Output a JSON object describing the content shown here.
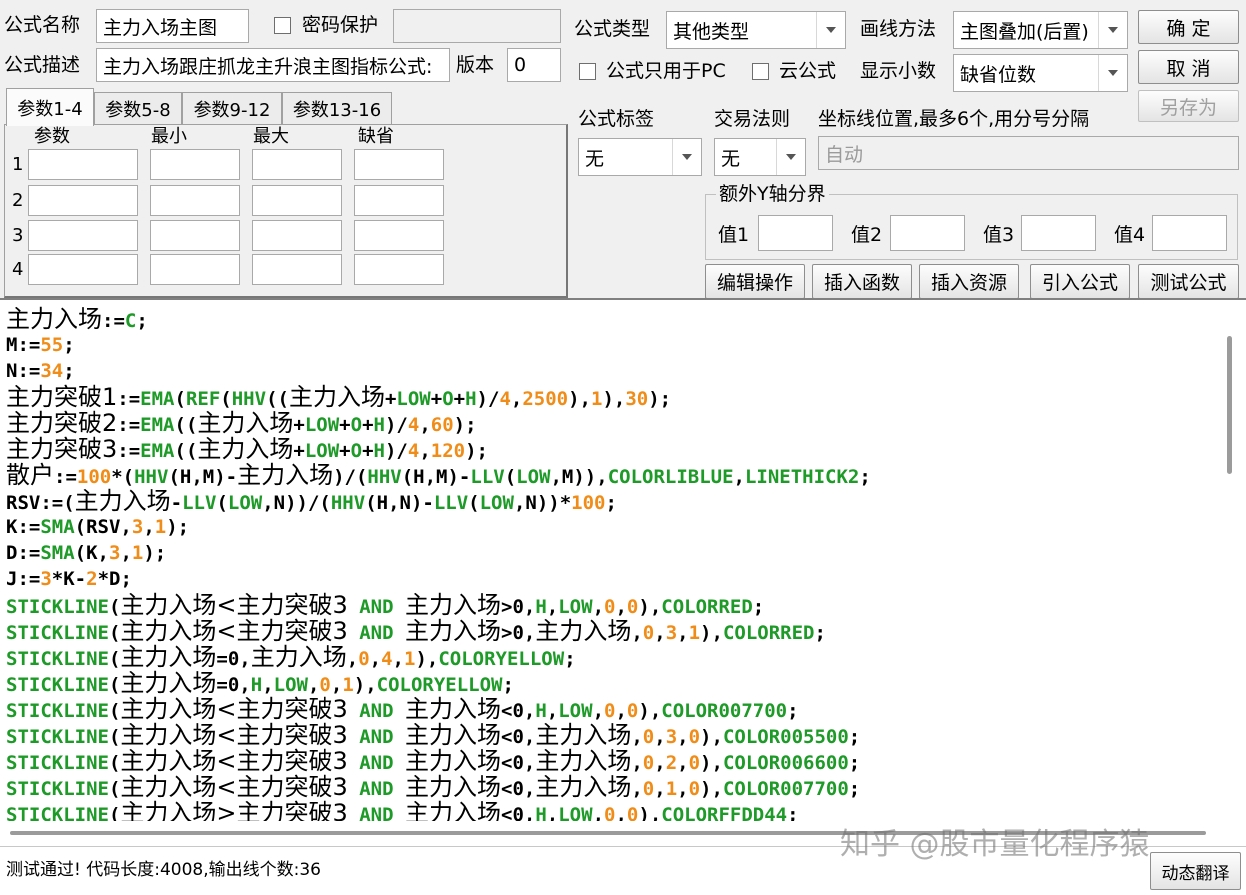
{
  "header": {
    "name_label": "公式名称",
    "name_value": "主力入场主图",
    "password_label": "密码保护",
    "desc_label": "公式描述",
    "desc_value": "主力入场跟庄抓龙主升浪主图指标公式:",
    "version_label": "版本",
    "version_value": "0",
    "type_label": "公式类型",
    "type_value": "其他类型",
    "draw_label": "画线方法",
    "draw_value": "主图叠加(后置)",
    "pc_only_label": "公式只用于PC",
    "cloud_label": "云公式",
    "decimal_label": "显示小数",
    "decimal_value": "缺省位数",
    "ok_label": "确  定",
    "cancel_label": "取  消",
    "saveas_label": "另存为"
  },
  "params": {
    "tabs": [
      "参数1-4",
      "参数5-8",
      "参数9-12",
      "参数13-16"
    ],
    "columns": [
      "参数",
      "最小",
      "最大",
      "缺省"
    ],
    "rows": [
      "1",
      "2",
      "3",
      "4"
    ]
  },
  "options": {
    "tag_label": "公式标签",
    "tag_value": "无",
    "rule_label": "交易法则",
    "rule_value": "无",
    "axis_label": "坐标线位置,最多6个,用分号分隔",
    "axis_value": "自动",
    "yaxis_group": "额外Y轴分界",
    "y_labels": [
      "值1",
      "值2",
      "值3",
      "值4"
    ]
  },
  "actions": [
    "编辑操作",
    "插入函数",
    "插入资源",
    "引入公式",
    "测试公式"
  ],
  "code_lines": [
    [
      [
        "k",
        "主力入场"
      ],
      [
        "o",
        ":="
      ],
      [
        "f",
        "C"
      ],
      [
        "o",
        ";"
      ]
    ],
    [
      [
        "k",
        "M"
      ],
      [
        "o",
        ":="
      ],
      [
        "n",
        "55"
      ],
      [
        "o",
        ";"
      ]
    ],
    [
      [
        "k",
        "N"
      ],
      [
        "o",
        ":="
      ],
      [
        "n",
        "34"
      ],
      [
        "o",
        ";"
      ]
    ],
    [
      [
        "k",
        "主力突破1"
      ],
      [
        "o",
        ":="
      ],
      [
        "f",
        "EMA"
      ],
      [
        "o",
        "("
      ],
      [
        "f",
        "REF"
      ],
      [
        "o",
        "("
      ],
      [
        "f",
        "HHV"
      ],
      [
        "o",
        "(("
      ],
      [
        "k",
        "主力入场"
      ],
      [
        "o",
        "+"
      ],
      [
        "f",
        "LOW"
      ],
      [
        "o",
        "+"
      ],
      [
        "f",
        "O"
      ],
      [
        "o",
        "+"
      ],
      [
        "f",
        "H"
      ],
      [
        "o",
        ")/"
      ],
      [
        "n",
        "4"
      ],
      [
        "o",
        ","
      ],
      [
        "n",
        "2500"
      ],
      [
        "o",
        "),"
      ],
      [
        "n",
        "1"
      ],
      [
        "o",
        "),"
      ],
      [
        "n",
        "30"
      ],
      [
        "o",
        ");"
      ]
    ],
    [
      [
        "k",
        "主力突破2"
      ],
      [
        "o",
        ":="
      ],
      [
        "f",
        "EMA"
      ],
      [
        "o",
        "(("
      ],
      [
        "k",
        "主力入场"
      ],
      [
        "o",
        "+"
      ],
      [
        "f",
        "LOW"
      ],
      [
        "o",
        "+"
      ],
      [
        "f",
        "O"
      ],
      [
        "o",
        "+"
      ],
      [
        "f",
        "H"
      ],
      [
        "o",
        ")/"
      ],
      [
        "n",
        "4"
      ],
      [
        "o",
        ","
      ],
      [
        "n",
        "60"
      ],
      [
        "o",
        ");"
      ]
    ],
    [
      [
        "k",
        "主力突破3"
      ],
      [
        "o",
        ":="
      ],
      [
        "f",
        "EMA"
      ],
      [
        "o",
        "(("
      ],
      [
        "k",
        "主力入场"
      ],
      [
        "o",
        "+"
      ],
      [
        "f",
        "LOW"
      ],
      [
        "o",
        "+"
      ],
      [
        "f",
        "O"
      ],
      [
        "o",
        "+"
      ],
      [
        "f",
        "H"
      ],
      [
        "o",
        ")/"
      ],
      [
        "n",
        "4"
      ],
      [
        "o",
        ","
      ],
      [
        "n",
        "120"
      ],
      [
        "o",
        ");"
      ]
    ],
    [
      [
        "k",
        "散户"
      ],
      [
        "o",
        ":="
      ],
      [
        "n",
        "100"
      ],
      [
        "o",
        "*("
      ],
      [
        "f",
        "HHV"
      ],
      [
        "o",
        "(H,M)-"
      ],
      [
        "k",
        "主力入场"
      ],
      [
        "o",
        ")/("
      ],
      [
        "f",
        "HHV"
      ],
      [
        "o",
        "(H,M)-"
      ],
      [
        "f",
        "LLV"
      ],
      [
        "o",
        "("
      ],
      [
        "f",
        "LOW"
      ],
      [
        "o",
        ",M)),"
      ],
      [
        "f",
        "COLORLIBLUE"
      ],
      [
        "o",
        ","
      ],
      [
        "f",
        "LINETHICK2"
      ],
      [
        "o",
        ";"
      ]
    ],
    [
      [
        "k",
        "RSV"
      ],
      [
        "o",
        ":=("
      ],
      [
        "k",
        "主力入场"
      ],
      [
        "o",
        "-"
      ],
      [
        "f",
        "LLV"
      ],
      [
        "o",
        "("
      ],
      [
        "f",
        "LOW"
      ],
      [
        "o",
        ",N))/("
      ],
      [
        "f",
        "HHV"
      ],
      [
        "o",
        "(H,N)-"
      ],
      [
        "f",
        "LLV"
      ],
      [
        "o",
        "("
      ],
      [
        "f",
        "LOW"
      ],
      [
        "o",
        ",N))*"
      ],
      [
        "n",
        "100"
      ],
      [
        "o",
        ";"
      ]
    ],
    [
      [
        "k",
        "K"
      ],
      [
        "o",
        ":="
      ],
      [
        "f",
        "SMA"
      ],
      [
        "o",
        "(RSV,"
      ],
      [
        "n",
        "3"
      ],
      [
        "o",
        ","
      ],
      [
        "n",
        "1"
      ],
      [
        "o",
        ");"
      ]
    ],
    [
      [
        "k",
        "D"
      ],
      [
        "o",
        ":="
      ],
      [
        "f",
        "SMA"
      ],
      [
        "o",
        "(K,"
      ],
      [
        "n",
        "3"
      ],
      [
        "o",
        ","
      ],
      [
        "n",
        "1"
      ],
      [
        "o",
        ");"
      ]
    ],
    [
      [
        "k",
        "J"
      ],
      [
        "o",
        ":="
      ],
      [
        "n",
        "3"
      ],
      [
        "o",
        "*K-"
      ],
      [
        "n",
        "2"
      ],
      [
        "o",
        "*D;"
      ]
    ],
    [
      [
        "f",
        "STICKLINE"
      ],
      [
        "o",
        "("
      ],
      [
        "k",
        "主力入场<主力突破3"
      ],
      [
        "f",
        " AND "
      ],
      [
        "k",
        "主力入场"
      ],
      [
        "o",
        ">0,"
      ],
      [
        "f",
        "H"
      ],
      [
        "o",
        ","
      ],
      [
        "f",
        "LOW"
      ],
      [
        "o",
        ","
      ],
      [
        "n",
        "0"
      ],
      [
        "o",
        ","
      ],
      [
        "n",
        "0"
      ],
      [
        "o",
        "),"
      ],
      [
        "f",
        "COLORRED"
      ],
      [
        "o",
        ";"
      ]
    ],
    [
      [
        "f",
        "STICKLINE"
      ],
      [
        "o",
        "("
      ],
      [
        "k",
        "主力入场<主力突破3"
      ],
      [
        "f",
        " AND "
      ],
      [
        "k",
        "主力入场"
      ],
      [
        "o",
        ">0,"
      ],
      [
        "k",
        "主力入场"
      ],
      [
        "o",
        ","
      ],
      [
        "n",
        "0"
      ],
      [
        "o",
        ","
      ],
      [
        "n",
        "3"
      ],
      [
        "o",
        ","
      ],
      [
        "n",
        "1"
      ],
      [
        "o",
        "),"
      ],
      [
        "f",
        "COLORRED"
      ],
      [
        "o",
        ";"
      ]
    ],
    [
      [
        "f",
        "STICKLINE"
      ],
      [
        "o",
        "("
      ],
      [
        "k",
        "主力入场"
      ],
      [
        "o",
        "=0,"
      ],
      [
        "k",
        "主力入场"
      ],
      [
        "o",
        ","
      ],
      [
        "n",
        "0"
      ],
      [
        "o",
        ","
      ],
      [
        "n",
        "4"
      ],
      [
        "o",
        ","
      ],
      [
        "n",
        "1"
      ],
      [
        "o",
        "),"
      ],
      [
        "f",
        "COLORYELLOW"
      ],
      [
        "o",
        ";"
      ]
    ],
    [
      [
        "f",
        "STICKLINE"
      ],
      [
        "o",
        "("
      ],
      [
        "k",
        "主力入场"
      ],
      [
        "o",
        "=0,"
      ],
      [
        "f",
        "H"
      ],
      [
        "o",
        ","
      ],
      [
        "f",
        "LOW"
      ],
      [
        "o",
        ","
      ],
      [
        "n",
        "0"
      ],
      [
        "o",
        ","
      ],
      [
        "n",
        "1"
      ],
      [
        "o",
        "),"
      ],
      [
        "f",
        "COLORYELLOW"
      ],
      [
        "o",
        ";"
      ]
    ],
    [
      [
        "f",
        "STICKLINE"
      ],
      [
        "o",
        "("
      ],
      [
        "k",
        "主力入场<主力突破3"
      ],
      [
        "f",
        " AND "
      ],
      [
        "k",
        "主力入场"
      ],
      [
        "o",
        "<0,"
      ],
      [
        "f",
        "H"
      ],
      [
        "o",
        ","
      ],
      [
        "f",
        "LOW"
      ],
      [
        "o",
        ","
      ],
      [
        "n",
        "0"
      ],
      [
        "o",
        ","
      ],
      [
        "n",
        "0"
      ],
      [
        "o",
        "),"
      ],
      [
        "f",
        "COLOR007700"
      ],
      [
        "o",
        ";"
      ]
    ],
    [
      [
        "f",
        "STICKLINE"
      ],
      [
        "o",
        "("
      ],
      [
        "k",
        "主力入场<主力突破3"
      ],
      [
        "f",
        " AND "
      ],
      [
        "k",
        "主力入场"
      ],
      [
        "o",
        "<0,"
      ],
      [
        "k",
        "主力入场"
      ],
      [
        "o",
        ","
      ],
      [
        "n",
        "0"
      ],
      [
        "o",
        ","
      ],
      [
        "n",
        "3"
      ],
      [
        "o",
        ","
      ],
      [
        "n",
        "0"
      ],
      [
        "o",
        "),"
      ],
      [
        "f",
        "COLOR005500"
      ],
      [
        "o",
        ";"
      ]
    ],
    [
      [
        "f",
        "STICKLINE"
      ],
      [
        "o",
        "("
      ],
      [
        "k",
        "主力入场<主力突破3"
      ],
      [
        "f",
        " AND "
      ],
      [
        "k",
        "主力入场"
      ],
      [
        "o",
        "<0,"
      ],
      [
        "k",
        "主力入场"
      ],
      [
        "o",
        ","
      ],
      [
        "n",
        "0"
      ],
      [
        "o",
        ","
      ],
      [
        "n",
        "2"
      ],
      [
        "o",
        ","
      ],
      [
        "n",
        "0"
      ],
      [
        "o",
        "),"
      ],
      [
        "f",
        "COLOR006600"
      ],
      [
        "o",
        ";"
      ]
    ],
    [
      [
        "f",
        "STICKLINE"
      ],
      [
        "o",
        "("
      ],
      [
        "k",
        "主力入场<主力突破3"
      ],
      [
        "f",
        " AND "
      ],
      [
        "k",
        "主力入场"
      ],
      [
        "o",
        "<0,"
      ],
      [
        "k",
        "主力入场"
      ],
      [
        "o",
        ","
      ],
      [
        "n",
        "0"
      ],
      [
        "o",
        ","
      ],
      [
        "n",
        "1"
      ],
      [
        "o",
        ","
      ],
      [
        "n",
        "0"
      ],
      [
        "o",
        "),"
      ],
      [
        "f",
        "COLOR007700"
      ],
      [
        "o",
        ";"
      ]
    ],
    [
      [
        "f",
        "STICKLINE"
      ],
      [
        "o",
        "("
      ],
      [
        "k",
        "主力入场>主力突破3"
      ],
      [
        "f",
        " AND "
      ],
      [
        "k",
        "主力入场"
      ],
      [
        "o",
        "<0,"
      ],
      [
        "f",
        "H"
      ],
      [
        "o",
        ","
      ],
      [
        "f",
        "LOW"
      ],
      [
        "o",
        ","
      ],
      [
        "n",
        "0"
      ],
      [
        "o",
        ","
      ],
      [
        "n",
        "0"
      ],
      [
        "o",
        "),"
      ],
      [
        "f",
        "COLORFFDD44"
      ],
      [
        "o",
        ";"
      ]
    ]
  ],
  "status_text": "测试通过! 代码长度:4008,输出线个数:36",
  "watermark": "知乎 @股市量化程序猿",
  "translate_label": "动态翻译",
  "colors": {
    "keyword": "#000000",
    "function": "#1e9a28",
    "number": "#f08c18"
  }
}
